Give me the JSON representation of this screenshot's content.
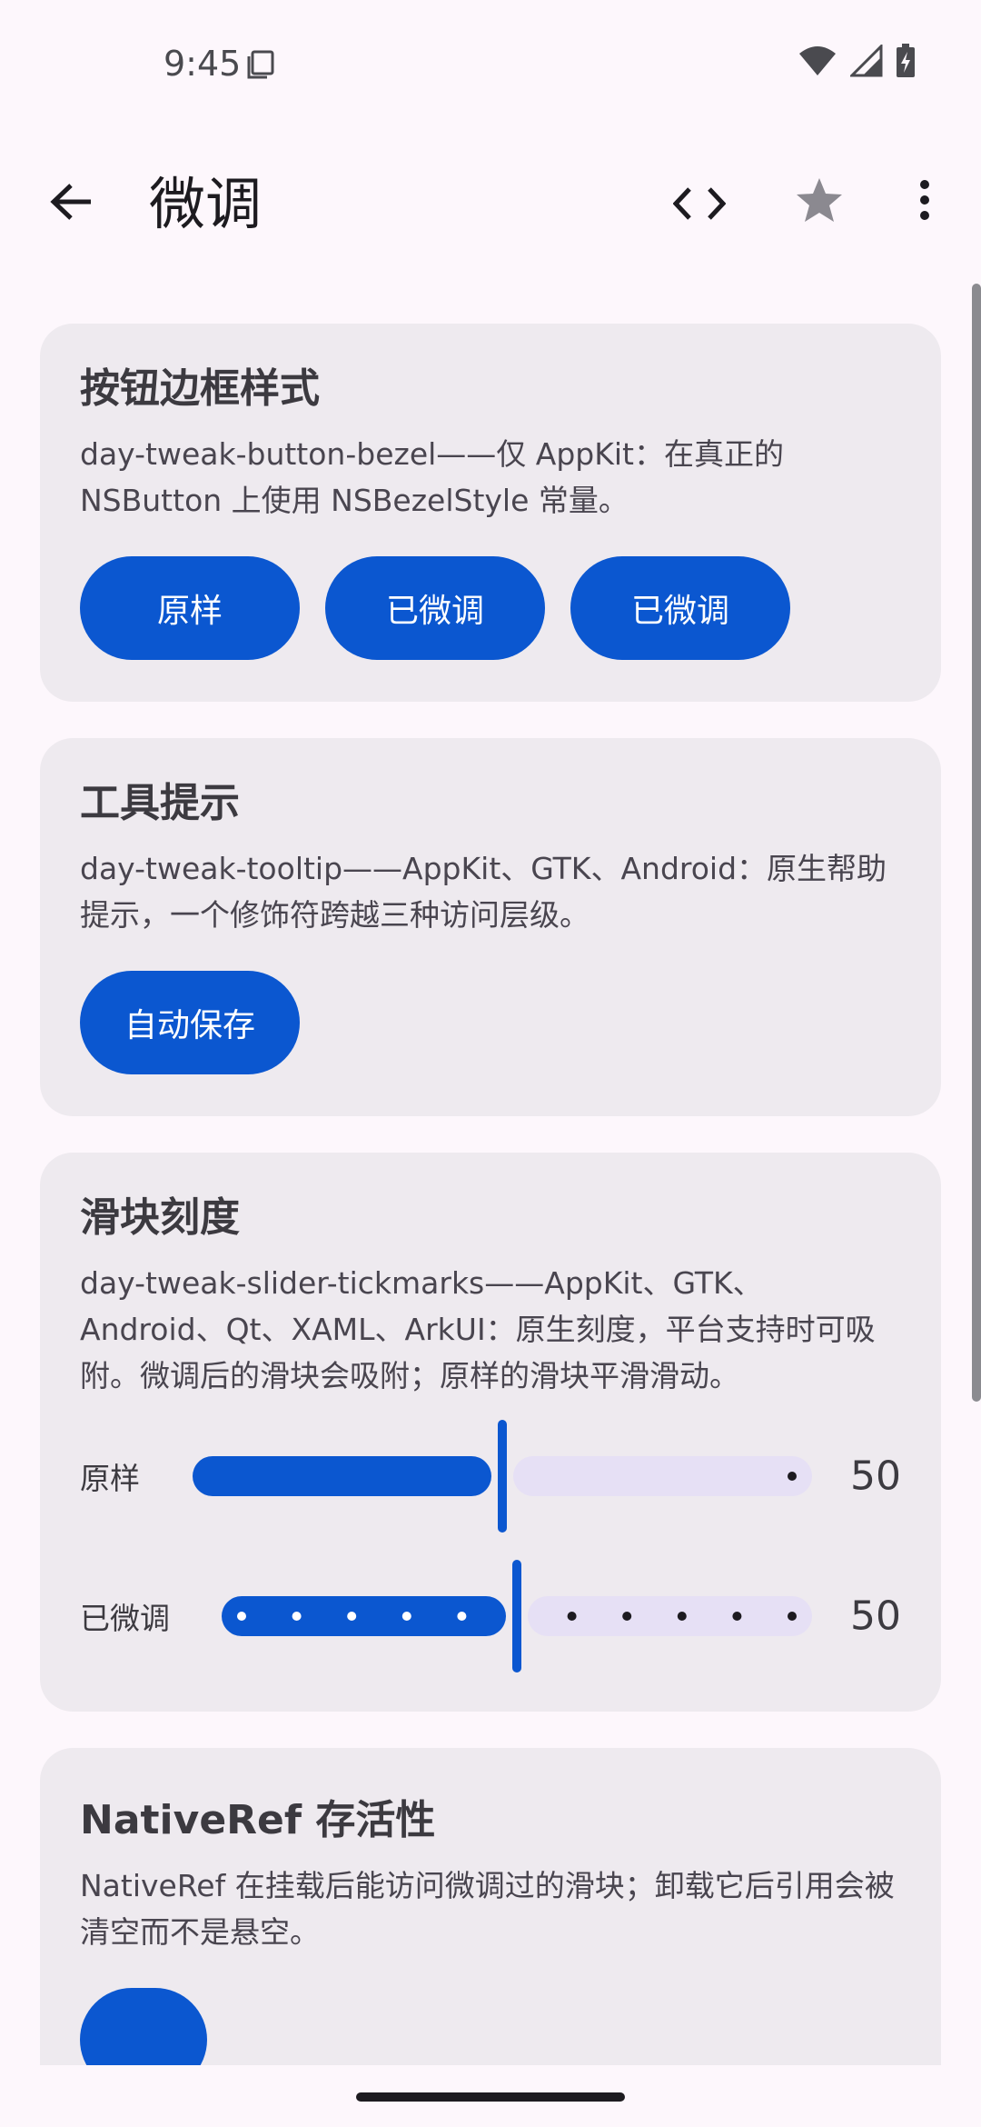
{
  "status": {
    "time": "9:45"
  },
  "app_bar": {
    "title": "微调",
    "icons": [
      "back-arrow-icon",
      "code-icon",
      "star-icon",
      "more-vert-icon"
    ]
  },
  "cards": [
    {
      "title": "按钮边框样式",
      "description": "day-tweak-button-bezel——仅 AppKit：在真正的 NSButton 上使用 NSBezelStyle 常量。",
      "buttons": [
        "原样",
        "已微调",
        "已微调"
      ]
    },
    {
      "title": "工具提示",
      "description": "day-tweak-tooltip——AppKit、GTK、Android：原生帮助提示，一个修饰符跨越三种访问层级。",
      "buttons": [
        "自动保存"
      ]
    },
    {
      "title": "滑块刻度",
      "description": "day-tweak-slider-tickmarks——AppKit、GTK、Android、Qt、XAML、ArkUI：原生刻度，平台支持时可吸附。微调后的滑块会吸附；原样的滑块平滑滑动。",
      "sliders": [
        {
          "label": "原样",
          "value": "50",
          "fraction": 0.5,
          "ticks": false
        },
        {
          "label": "已微调",
          "value": "50",
          "fraction": 0.5,
          "ticks": true
        }
      ]
    },
    {
      "title": "NativeRef 存活性",
      "description": "NativeRef 在挂载后能访问微调过的滑块；卸载它后引用会被清空而不是悬空。"
    }
  ],
  "colors": {
    "accent": "#0b57d0",
    "card_bg": "#eeeaef",
    "inactive_track": "#e6e0f5",
    "page_bg": "#fdf7fc"
  }
}
